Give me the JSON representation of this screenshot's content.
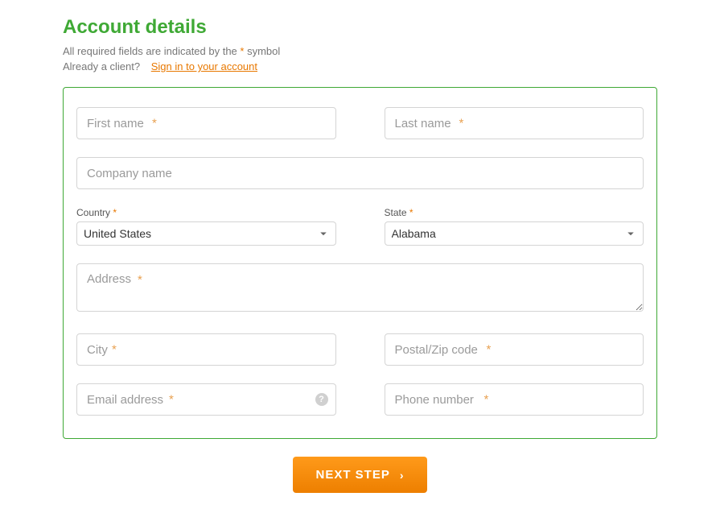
{
  "header": {
    "title": "Account details",
    "required_note_prefix": "All required fields are indicated by the ",
    "required_note_suffix": " symbol",
    "asterisk": "*",
    "already_client": "Already a client?",
    "sign_in_link": "Sign in to your account"
  },
  "fields": {
    "first_name": {
      "placeholder": "First name "
    },
    "last_name": {
      "placeholder": "Last name "
    },
    "company_name": {
      "placeholder": "Company name"
    },
    "country": {
      "label": "Country ",
      "req": "*",
      "selected": "United States"
    },
    "state": {
      "label": "State ",
      "req": "*",
      "selected": "Alabama"
    },
    "address": {
      "placeholder": "Address "
    },
    "city": {
      "placeholder": "City "
    },
    "postal": {
      "placeholder": "Postal/Zip code "
    },
    "email": {
      "placeholder": "Email address "
    },
    "phone": {
      "placeholder": "Phone number "
    }
  },
  "button": {
    "next_step": "NEXT STEP"
  }
}
